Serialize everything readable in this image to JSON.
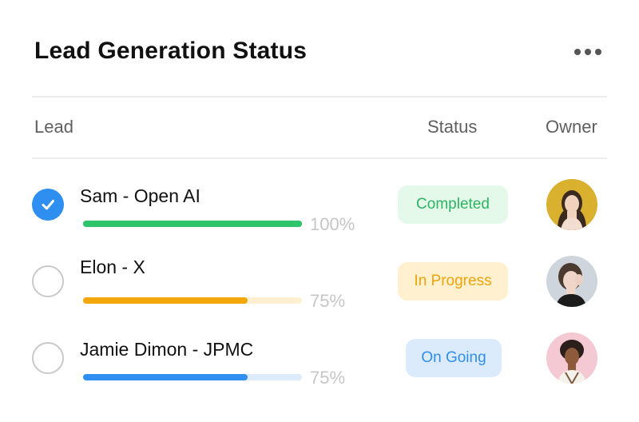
{
  "header": {
    "title": "Lead Generation Status",
    "menu_icon": "more-horizontal-icon"
  },
  "columns": {
    "lead": "Lead",
    "status": "Status",
    "owner": "Owner"
  },
  "leads": [
    {
      "name": "Sam - Open AI",
      "checked": true,
      "progress": 1.0,
      "progress_label": "100%",
      "bar_color": "#2ec46a",
      "track_color": "#2ec46a",
      "status": "Completed",
      "status_text_color": "#2db563",
      "status_bg_color": "#e5f9eb",
      "avatar_icon": "woman-portrait-avatar"
    },
    {
      "name": "Elon - X",
      "checked": false,
      "progress": 0.75,
      "progress_label": "75%",
      "bar_color": "#f3a70a",
      "track_color": "#fdf0d2",
      "status": "In Progress",
      "status_text_color": "#f0a30a",
      "status_bg_color": "#fff1cf",
      "avatar_icon": "woman-portrait-avatar"
    },
    {
      "name": "Jamie Dimon - JPMC",
      "checked": false,
      "progress": 0.75,
      "progress_label": "75%",
      "bar_color": "#2f8ff0",
      "track_color": "#dcebfb",
      "status": "On Going",
      "status_text_color": "#2f8ff0",
      "status_bg_color": "#dcebfb",
      "avatar_icon": "woman-portrait-avatar"
    }
  ]
}
